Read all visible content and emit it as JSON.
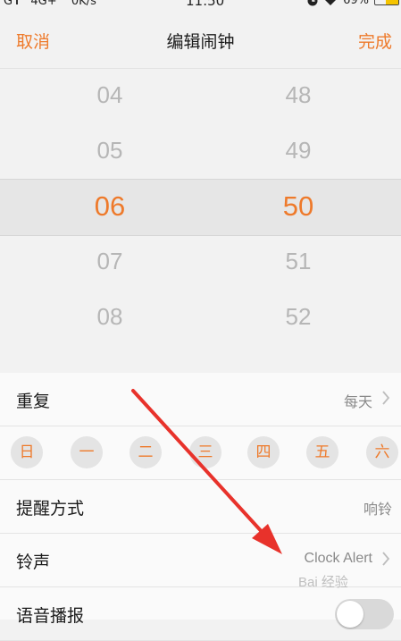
{
  "status_bar": {
    "network": "G",
    "cellular": "4G+",
    "speed": "0K/s",
    "time": "11:50",
    "battery": "69%",
    "battery_level_fraction": 0.69
  },
  "header": {
    "cancel_label": "取消",
    "title": "编辑闹钟",
    "done_label": "完成"
  },
  "picker": {
    "hours": [
      "04",
      "05",
      "06",
      "07",
      "08"
    ],
    "minutes": [
      "48",
      "49",
      "50",
      "51",
      "52"
    ],
    "selected_hour": "06",
    "selected_minute": "50"
  },
  "settings": {
    "repeat": {
      "label": "重复",
      "value": "每天"
    },
    "days": [
      "日",
      "一",
      "二",
      "三",
      "四",
      "五",
      "六"
    ],
    "reminder": {
      "label": "提醒方式",
      "value": "响铃"
    },
    "ringtone": {
      "label": "铃声",
      "value": "Clock Alert"
    },
    "voice": {
      "label": "语音播报",
      "enabled": false
    }
  },
  "watermark": "Bai 经验",
  "colors": {
    "accent": "#ee7a2b",
    "annotation_arrow": "#e8322b",
    "background": "#f2f2f2"
  }
}
